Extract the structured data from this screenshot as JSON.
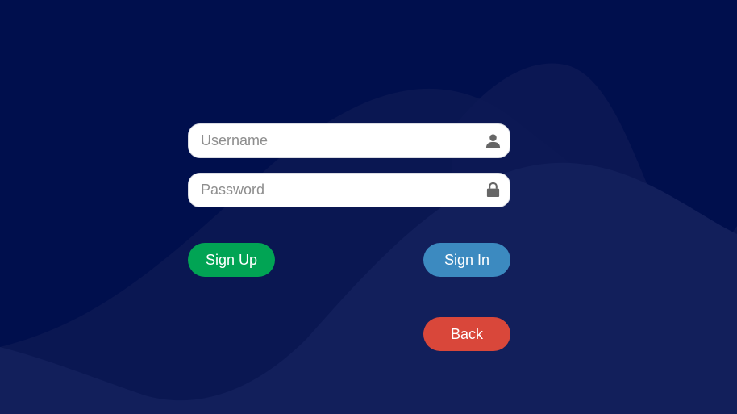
{
  "login_form": {
    "username": {
      "placeholder": "Username",
      "value": "",
      "icon": "user-icon"
    },
    "password": {
      "placeholder": "Password",
      "value": "",
      "icon": "lock-icon"
    }
  },
  "actions": {
    "sign_up_label": "Sign Up",
    "sign_in_label": "Sign In",
    "back_label": "Back"
  },
  "colors": {
    "background": "#000f4d",
    "wave": "#14205a",
    "sign_up": "#01a454",
    "sign_in": "#3c8ac0",
    "back": "#d9473a"
  }
}
